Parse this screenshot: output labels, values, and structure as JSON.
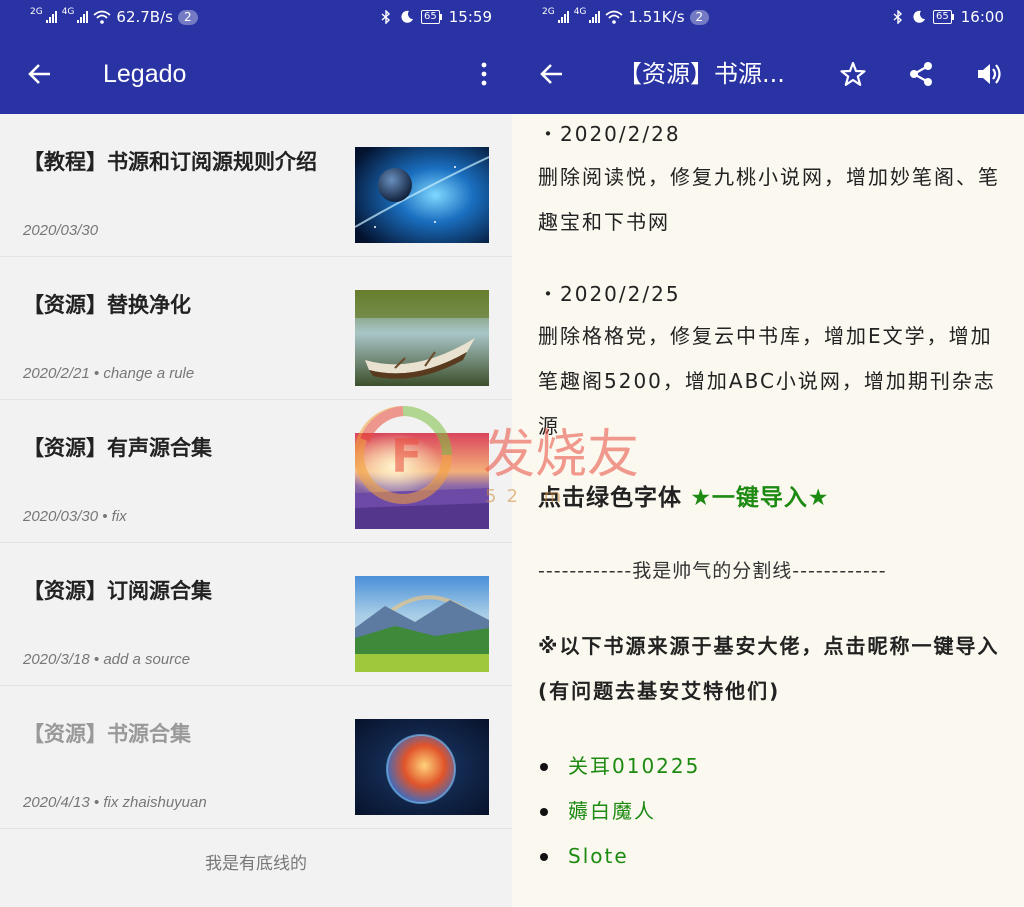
{
  "left": {
    "status": {
      "net1": "2G",
      "net2": "4G",
      "speed": "62.7B/s",
      "badge": "2",
      "battery": "65",
      "time": "15:59"
    },
    "app_title": "Legado",
    "items": [
      {
        "title": "【教程】书源和订阅源规则介绍",
        "meta": "2020/03/30",
        "thumb": "planet-space"
      },
      {
        "title": "【资源】替换净化",
        "meta": "2020/2/21 • change a rule",
        "thumb": "boat-lake"
      },
      {
        "title": "【资源】有声源合集",
        "meta": "2020/03/30 • fix",
        "thumb": "lavender-sunset"
      },
      {
        "title": "【资源】订阅源合集",
        "meta": "2020/3/18 • add a source",
        "thumb": "mountain-rainbow"
      },
      {
        "title": "【资源】书源合集",
        "meta": "2020/4/13 • fix zhaishuyuan",
        "thumb": "earth-fire"
      }
    ],
    "footer": "我是有底线的"
  },
  "right": {
    "status": {
      "net1": "2G",
      "net2": "4G",
      "speed": "1.51K/s",
      "badge": "2",
      "battery": "65",
      "time": "16:00"
    },
    "title": "【资源】书源...",
    "date1": "・2020/2/28",
    "text1": "删除阅读悦，修复九桃小说网，增加妙笔阁、笔趣宝和下书网",
    "date2": "・2020/2/25",
    "text2": "删除格格党，修复云中书库，增加E文学，增加笔趣阁5200，增加ABC小说网，增加期刊杂志源",
    "import_prefix": "点击绿色字体",
    "import_link": "★一键导入★",
    "divider": "------------我是帅气的分割线------------",
    "notice": "※以下书源来源于基安大佬，点击昵称一键导入(有问题去基安艾特他们)",
    "links": [
      "关耳010225",
      "薅白魔人",
      "Slote"
    ]
  },
  "watermark": {
    "text": "发烧友",
    "sub": "52 m"
  },
  "colors": {
    "primary": "#2a33a3",
    "link_green": "#1d8a12",
    "page_bg": "#fbf8ef",
    "list_bg": "#f2f2f2"
  }
}
